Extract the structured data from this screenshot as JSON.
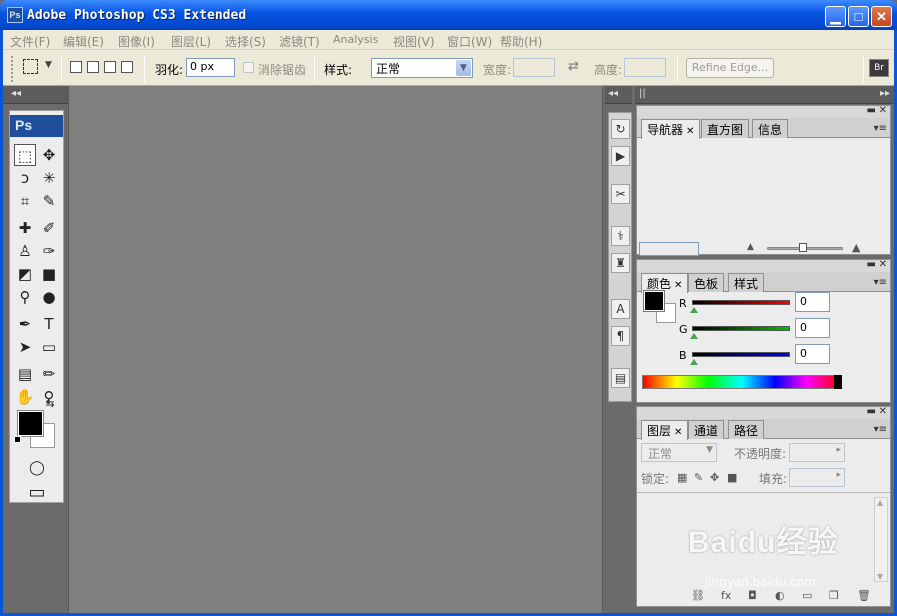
{
  "window": {
    "title": "Adobe Photoshop CS3 Extended",
    "icon_text": "Ps"
  },
  "window_buttons": {
    "minimize": "▁",
    "maximize": "□",
    "close": "✕"
  },
  "menu": [
    {
      "label": "文件(F)"
    },
    {
      "label": "编辑(E)"
    },
    {
      "label": "图像(I)"
    },
    {
      "label": "图层(L)"
    },
    {
      "label": "选择(S)"
    },
    {
      "label": "滤镜(T)"
    },
    {
      "label": "Analysis"
    },
    {
      "label": "视图(V)"
    },
    {
      "label": "窗口(W)"
    },
    {
      "label": "帮助(H)"
    }
  ],
  "options": {
    "feather_label": "羽化:",
    "feather_value": "0 px",
    "antialias_label": "消除锯齿",
    "style_label": "样式:",
    "style_value": "正常",
    "width_label": "宽度:",
    "height_label": "高度:",
    "refine_edge": "Refine Edge...",
    "swap_glyph": "⇄",
    "bridge_glyph": "Br"
  },
  "toolbox": {
    "header": "Ps",
    "tools": [
      {
        "name": "rectangular-marquee-tool-icon",
        "glyph": "⬚"
      },
      {
        "name": "move-tool-icon",
        "glyph": "✥"
      },
      {
        "name": "lasso-tool-icon",
        "glyph": "ↄ"
      },
      {
        "name": "magic-wand-tool-icon",
        "glyph": "✳"
      },
      {
        "name": "crop-tool-icon",
        "glyph": "⌗"
      },
      {
        "name": "slice-tool-icon",
        "glyph": "✎"
      },
      {
        "name": "healing-brush-tool-icon",
        "glyph": "✚"
      },
      {
        "name": "brush-tool-icon",
        "glyph": "✐"
      },
      {
        "name": "clone-stamp-tool-icon",
        "glyph": "♙"
      },
      {
        "name": "history-brush-tool-icon",
        "glyph": "✑"
      },
      {
        "name": "eraser-tool-icon",
        "glyph": "◩"
      },
      {
        "name": "gradient-tool-icon",
        "glyph": "■"
      },
      {
        "name": "blur-tool-icon",
        "glyph": "⚲"
      },
      {
        "name": "dodge-tool-icon",
        "glyph": "●"
      },
      {
        "name": "pen-tool-icon",
        "glyph": "✒"
      },
      {
        "name": "type-tool-icon",
        "glyph": "T"
      },
      {
        "name": "path-selection-tool-icon",
        "glyph": "➤"
      },
      {
        "name": "rectangle-tool-icon",
        "glyph": "▭"
      },
      {
        "name": "notes-tool-icon",
        "glyph": "▤"
      },
      {
        "name": "eyedropper-tool-icon",
        "glyph": "✏"
      },
      {
        "name": "hand-tool-icon",
        "glyph": "✋"
      },
      {
        "name": "zoom-tool-icon",
        "glyph": "⚲"
      }
    ],
    "swap_glyph": "⇆",
    "quickmask_glyph": "◯",
    "screenmode_glyph": "▭",
    "foreground_color": "#000000",
    "background_color": "#ffffff"
  },
  "dock": [
    {
      "name": "history-panel-icon",
      "glyph": "↻"
    },
    {
      "name": "actions-panel-icon",
      "glyph": "▶"
    },
    {
      "name": "tool-presets-icon",
      "glyph": "✂"
    },
    {
      "name": "brushes-panel-icon",
      "glyph": "⚕"
    },
    {
      "name": "clone-source-icon",
      "glyph": "♜"
    },
    {
      "name": "character-panel-icon",
      "glyph": "A"
    },
    {
      "name": "paragraph-panel-icon",
      "glyph": "¶"
    },
    {
      "name": "layer-comps-icon",
      "glyph": "▤"
    }
  ],
  "panels": {
    "navigator": {
      "tabs": [
        "导航器",
        "直方图",
        "信息"
      ]
    },
    "color": {
      "tabs": [
        "颜色",
        "色板",
        "样式"
      ],
      "channels": [
        {
          "label": "R",
          "value": "0",
          "color": "#ff0000"
        },
        {
          "label": "G",
          "value": "0",
          "color": "#00c000"
        },
        {
          "label": "B",
          "value": "0",
          "color": "#0000ff"
        }
      ]
    },
    "layers": {
      "tabs": [
        "图层",
        "通道",
        "路径"
      ],
      "blend_mode": "正常",
      "opacity_label": "不透明度:",
      "lock_label": "锁定:",
      "fill_label": "填充:"
    }
  },
  "watermark": {
    "text": "Baidu经验",
    "sub": "jingyan.baidu.com"
  }
}
